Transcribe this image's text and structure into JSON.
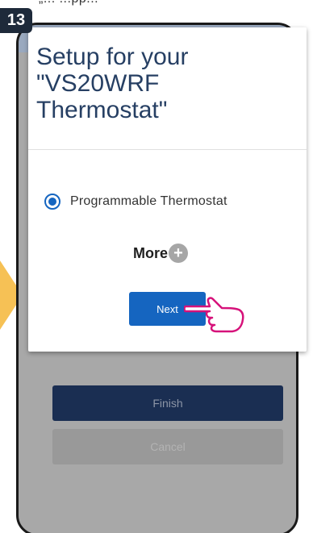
{
  "step_badge": "13",
  "top_caption": "„... ...pp...",
  "dialog": {
    "title": "Setup for your\n\"VS20WRF\nThermostat\"",
    "radio_option_label": "Programmable Thermostat",
    "radio_selected": true,
    "more_label": "More",
    "more_plus": "+",
    "next_label": "Next"
  },
  "background_screen": {
    "finish_label": "Finish",
    "cancel_label": "Cancel"
  },
  "colors": {
    "accent_blue": "#1565c0",
    "title_navy": "#263f63",
    "step_badge_bg": "#1e2a3a",
    "arrow_marker": "#f6c155",
    "hand_pointer": "#d6127a",
    "finish_bg": "#1a2e52"
  },
  "icons": {
    "radio": "radio-selected-icon",
    "more": "plus-circle-icon",
    "pointer": "pointing-hand-icon",
    "marker": "arrow-marker-icon"
  }
}
